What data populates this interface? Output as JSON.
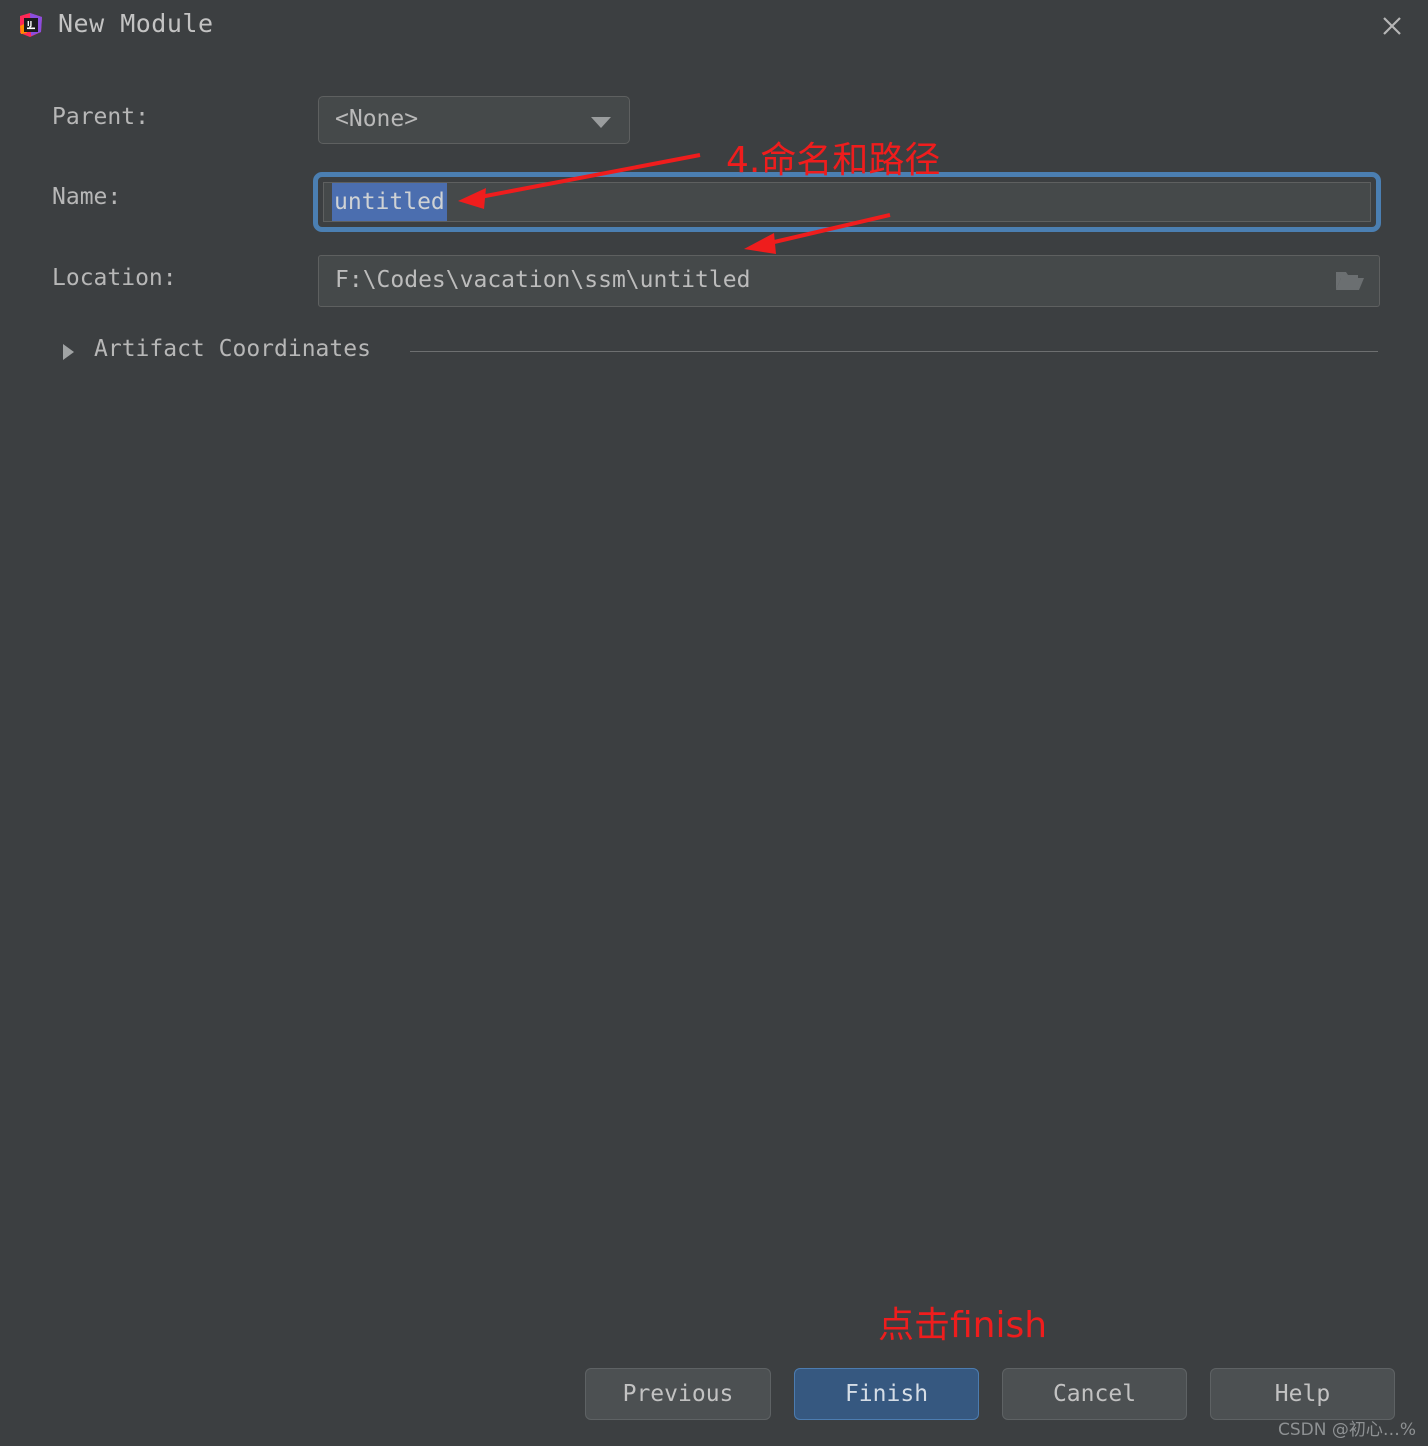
{
  "window": {
    "title": "New Module",
    "app_icon": "intellij-idea-icon",
    "close_icon": "close-icon"
  },
  "form": {
    "parent": {
      "label": "Parent:",
      "value": "<None>",
      "dropdown_icon": "chevron-down-icon"
    },
    "name": {
      "label": "Name:",
      "value": "untitled",
      "focused": true,
      "selected": true
    },
    "location": {
      "label": "Location:",
      "value": "F:\\Codes\\vacation\\ssm\\untitled",
      "browse_icon": "folder-icon"
    },
    "artifact_coordinates": {
      "label": "Artifact Coordinates",
      "expanded": false,
      "toggle_icon": "triangle-right-icon"
    }
  },
  "annotations": [
    {
      "text": "4.命名和路径",
      "color": "#ef1d1d"
    },
    {
      "text": "点击finish",
      "color": "#ef1d1d"
    }
  ],
  "buttons": {
    "previous": "Previous",
    "finish": "Finish",
    "cancel": "Cancel",
    "help": "Help"
  },
  "watermark": "CSDN @初心…%",
  "colors": {
    "background": "#3c3f41",
    "field_background": "#45494a",
    "field_border": "#5e6060",
    "focus_ring": "#4b7fb2",
    "selection": "#4b6eaf",
    "accent_button": "#365880",
    "annotation_red": "#ef1d1d",
    "text": "#bbbbbb"
  }
}
